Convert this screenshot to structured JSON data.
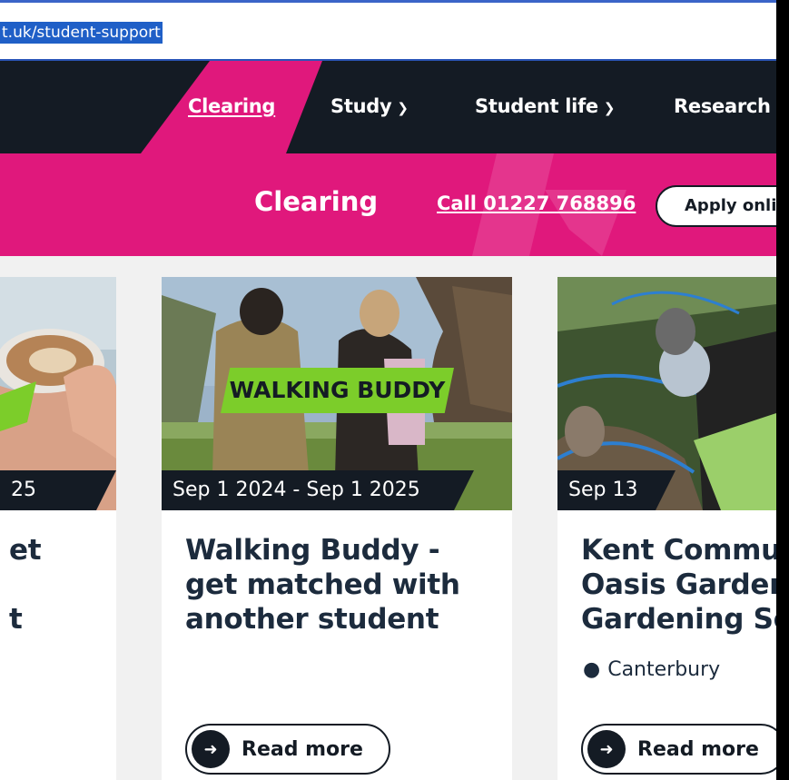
{
  "browser": {
    "url": "t.uk/student-support"
  },
  "nav": {
    "items": [
      {
        "label": "Clearing"
      },
      {
        "label": "Study"
      },
      {
        "label": "Student life"
      },
      {
        "label": "Research"
      }
    ]
  },
  "clearing": {
    "title": "Clearing",
    "call": "Call 01227 768896",
    "apply": "Apply online"
  },
  "cards": [
    {
      "date": "25",
      "title_lines": [
        "et",
        "",
        "t"
      ]
    },
    {
      "date": "Sep 1 2024 - Sep 1 2025",
      "tag": "WALKING BUDDY",
      "title_lines": [
        "Walking Buddy -",
        "get matched with",
        "another student"
      ],
      "read_more": "Read more"
    },
    {
      "date": "Sep 13",
      "title_lines": [
        "Kent Commu",
        "Oasis Garden",
        "Gardening Se"
      ],
      "location": "Canterbury",
      "read_more": "Read more"
    }
  ],
  "colors": {
    "brand_pink": "#e0187c",
    "dark": "#141b24",
    "lime": "#7ccd2a"
  },
  "icons": [
    "chevron-down-icon",
    "arrow-right-icon",
    "map-pin-icon"
  ]
}
